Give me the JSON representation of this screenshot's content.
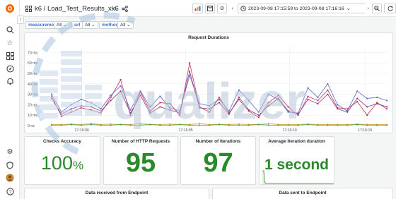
{
  "nav": {
    "title": "k6  /  Load_Test_Results_xk6",
    "time_range": "2023-09-08 17:15:59 to 2023-09-08 17:16:16"
  },
  "variables": [
    {
      "label": "measurement",
      "value": "All"
    },
    {
      "label": "url",
      "value": "All"
    },
    {
      "label": "method",
      "value": "All"
    }
  ],
  "chart_panel": {
    "title": "Request Durations"
  },
  "chart_data": {
    "type": "line",
    "title": "Request Durations",
    "ylim": [
      0,
      75
    ],
    "y_ticks": [
      "0 ns",
      "10 ms",
      "20 ms",
      "30 ms",
      "40 ms",
      "50 ms",
      "60 ms",
      "70 ms"
    ],
    "x_ticks": [
      "17:16:00",
      "17:16:05",
      "17:16:10",
      "17:16:15"
    ],
    "x": [
      0,
      1,
      2,
      3,
      4,
      5,
      6,
      7,
      8,
      9,
      10,
      11,
      12,
      13,
      14,
      15,
      16,
      17,
      18,
      19,
      20,
      21,
      22,
      23,
      24,
      25,
      26,
      27,
      28,
      29,
      30,
      31,
      32,
      33,
      34
    ],
    "series": [
      {
        "color": "#c4314b",
        "values": [
          28,
          9,
          13,
          17,
          15,
          12,
          27,
          44,
          10,
          32,
          14,
          22,
          21,
          10,
          60,
          18,
          13,
          27,
          12,
          25,
          14,
          8,
          22,
          29,
          18,
          10,
          28,
          24,
          34,
          17,
          16,
          23,
          10,
          22,
          16
        ]
      },
      {
        "color": "#5b6cc9",
        "values": [
          30,
          13,
          20,
          25,
          22,
          16,
          29,
          38,
          15,
          33,
          18,
          28,
          17,
          14,
          48,
          21,
          19,
          25,
          14,
          34,
          24,
          13,
          30,
          25,
          13,
          12,
          36,
          27,
          40,
          20,
          14,
          33,
          26,
          27,
          24
        ]
      },
      {
        "color": "#8a3a8e",
        "values": [
          26,
          11,
          16,
          19,
          18,
          14,
          24,
          33,
          12,
          29,
          12,
          18,
          15,
          12,
          52,
          17,
          16,
          22,
          11,
          27,
          15,
          10,
          19,
          26,
          14,
          11,
          25,
          21,
          30,
          16,
          13,
          26,
          18,
          21,
          18
        ]
      },
      {
        "color": "#e5a93a",
        "values": [
          1,
          1,
          1.5,
          1,
          2,
          1,
          1.5,
          1,
          1,
          2,
          1,
          1,
          1.5,
          1,
          1,
          2,
          1,
          1,
          1,
          1.5,
          1,
          1,
          2,
          1,
          1,
          1,
          1.5,
          1,
          1,
          1,
          1,
          1.5,
          1,
          1,
          1
        ]
      },
      {
        "color": "#4a9e4a",
        "values": [
          0.5,
          0.5,
          1,
          0.5,
          1,
          0.5,
          0.5,
          1,
          0.5,
          0.5,
          1,
          0.5,
          0.5,
          1,
          0.5,
          0.5,
          0.5,
          1,
          0.5,
          0.5,
          0.5,
          1,
          0.5,
          0.5,
          0.5,
          0.5,
          1,
          0.5,
          0.5,
          0.5,
          0.5,
          1,
          0.5,
          0.5,
          0.5
        ]
      }
    ]
  },
  "stats": [
    {
      "title": "Checks Accuracy",
      "value": "100",
      "unit": "%"
    },
    {
      "title": "Number of HTTP Requests",
      "value": "95",
      "unit": ""
    },
    {
      "title": "Number of Iterations",
      "value": "97",
      "unit": ""
    },
    {
      "title": "Average Iteration duration",
      "value": "1 second",
      "unit": ""
    }
  ],
  "bottom_panels": [
    {
      "title": "Data received from Endpoint"
    },
    {
      "title": "Data sent to Endpoint"
    }
  ],
  "watermark": "qualizer",
  "colors": {
    "accent": "#3871dc",
    "stat_green": "#2a8a2a",
    "watermark": "#c7d7ea"
  }
}
